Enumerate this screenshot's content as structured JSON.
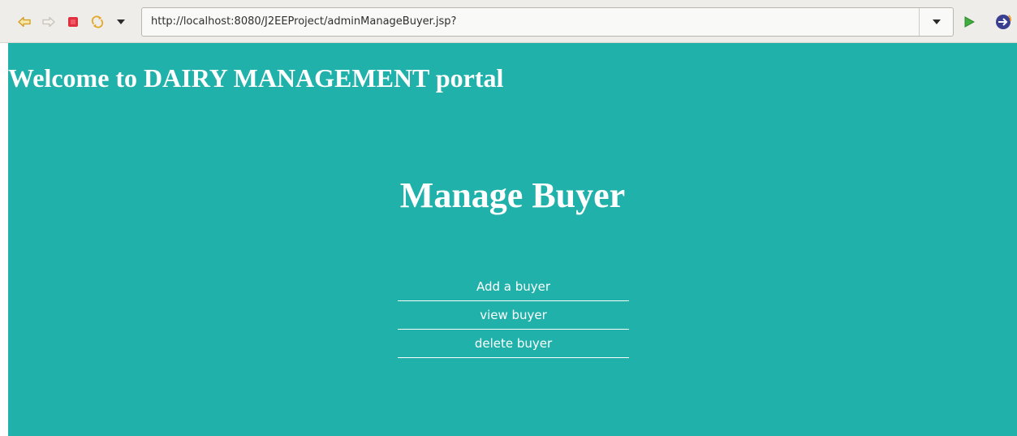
{
  "browser": {
    "url": "http://localhost:8080/J2EEProject/adminManageBuyer.jsp?",
    "icons": [
      "back-arrow-icon",
      "forward-arrow-icon",
      "stop-icon",
      "refresh-icon",
      "dropdown-icon",
      "url-dropdown-icon",
      "go-icon",
      "eclipse-icon"
    ]
  },
  "page": {
    "welcome": "Welcome to DAIRY MANAGEMENT portal",
    "title": "Manage Buyer",
    "menu": [
      "Add a buyer",
      "view buyer",
      "delete buyer"
    ]
  },
  "colors": {
    "background": "#20b2aa",
    "text": "#ffffff",
    "toolbar": "#efedea"
  }
}
